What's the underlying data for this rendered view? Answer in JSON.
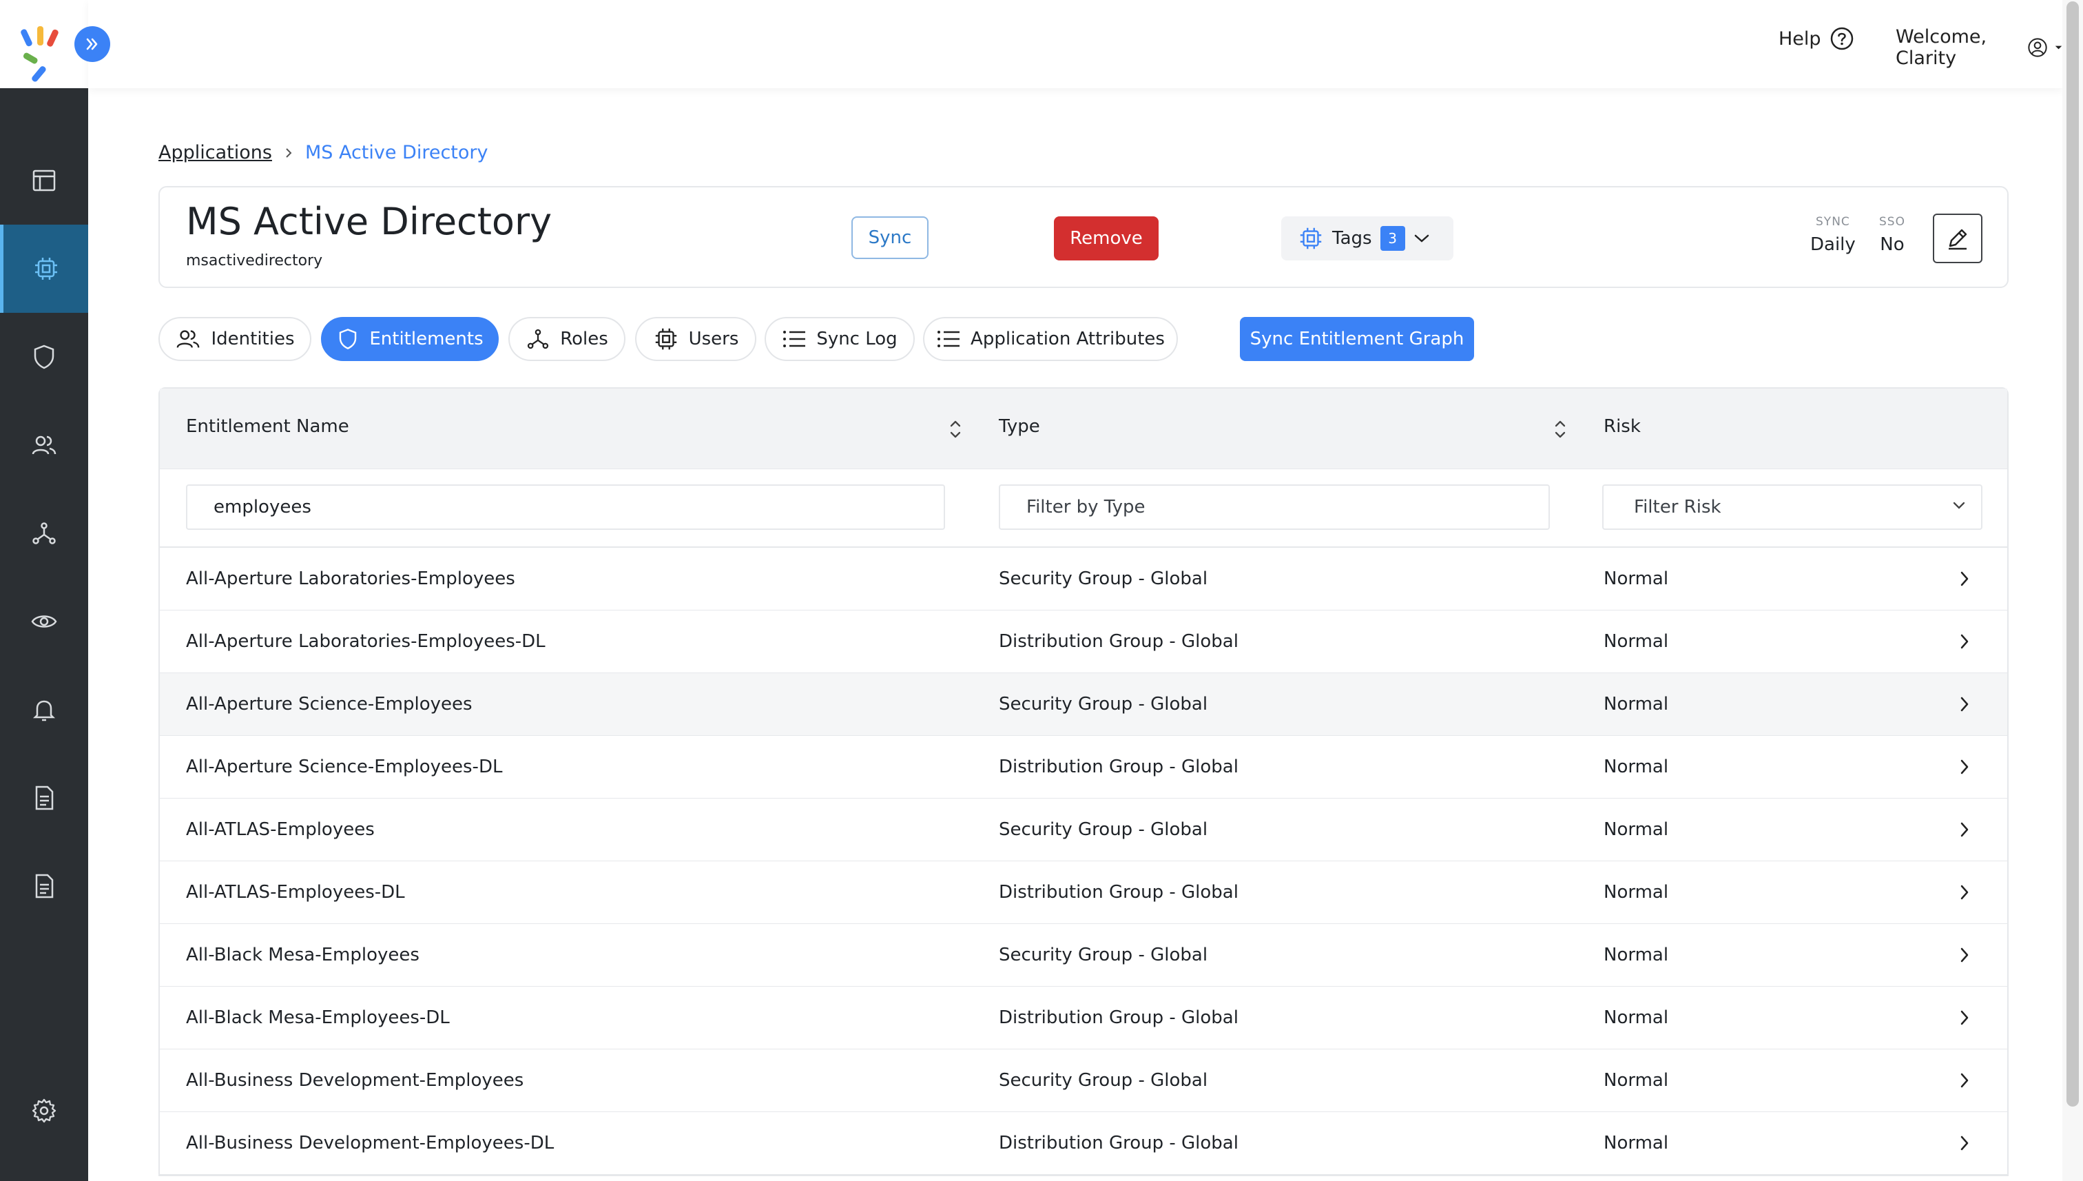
{
  "header": {
    "help_label": "Help",
    "welcome_label": "Welcome, Clarity"
  },
  "breadcrumb": {
    "parent": "Applications",
    "current": "MS Active Directory"
  },
  "app": {
    "title": "MS Active Directory",
    "subtitle": "msactivedirectory",
    "sync_label": "Sync",
    "remove_label": "Remove",
    "tags_label": "Tags",
    "tags_count": "3",
    "sync_meta_label": "SYNC",
    "sync_meta_value": "Daily",
    "sso_meta_label": "SSO",
    "sso_meta_value": "No"
  },
  "tabs": [
    {
      "label": "Identities",
      "icon": "identities-icon"
    },
    {
      "label": "Entitlements",
      "icon": "shield-icon",
      "active": true
    },
    {
      "label": "Roles",
      "icon": "roles-icon"
    },
    {
      "label": "Users",
      "icon": "chip-icon"
    },
    {
      "label": "Sync Log",
      "icon": "list-icon"
    },
    {
      "label": "Application Attributes",
      "icon": "list-icon"
    }
  ],
  "sync_graph_label": "Sync Entitlement Graph",
  "table": {
    "columns": [
      "Entitlement Name",
      "Type",
      "Risk"
    ],
    "filters": {
      "name_value": "employees",
      "type_placeholder": "Filter by Type",
      "risk_placeholder": "Filter Risk"
    },
    "rows": [
      {
        "name": "All-Aperture Laboratories-Employees",
        "type": "Security Group - Global",
        "risk": "Normal"
      },
      {
        "name": "All-Aperture Laboratories-Employees-DL",
        "type": "Distribution Group - Global",
        "risk": "Normal"
      },
      {
        "name": "All-Aperture Science-Employees",
        "type": "Security Group - Global",
        "risk": "Normal"
      },
      {
        "name": "All-Aperture Science-Employees-DL",
        "type": "Distribution Group - Global",
        "risk": "Normal"
      },
      {
        "name": "All-ATLAS-Employees",
        "type": "Security Group - Global",
        "risk": "Normal"
      },
      {
        "name": "All-ATLAS-Employees-DL",
        "type": "Distribution Group - Global",
        "risk": "Normal"
      },
      {
        "name": "All-Black Mesa-Employees",
        "type": "Security Group - Global",
        "risk": "Normal"
      },
      {
        "name": "All-Black Mesa-Employees-DL",
        "type": "Distribution Group - Global",
        "risk": "Normal"
      },
      {
        "name": "All-Business Development-Employees",
        "type": "Security Group - Global",
        "risk": "Normal"
      },
      {
        "name": "All-Business Development-Employees-DL",
        "type": "Distribution Group - Global",
        "risk": "Normal"
      }
    ]
  },
  "colors": {
    "accent": "#3b82f6",
    "danger": "#d32f2f",
    "sidebar": "#2b2f33",
    "sidebar_active": "#1e5f87"
  }
}
